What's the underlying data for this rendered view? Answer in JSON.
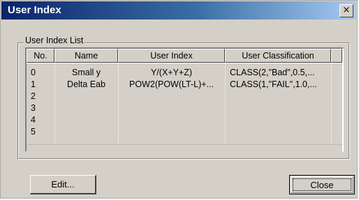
{
  "window": {
    "title": "User Index",
    "close_glyph": "×"
  },
  "group": {
    "label": "User Index List"
  },
  "table": {
    "columns": [
      "No.",
      "Name",
      "User Index",
      "User Classification"
    ],
    "rows": [
      {
        "no": "0",
        "name": "Small y",
        "index": "Y/(X+Y+Z)",
        "classification": "CLASS(2,\"Bad\",0.5,..."
      },
      {
        "no": "1",
        "name": "Delta Eab",
        "index": "POW2(POW(LT-L)+...",
        "classification": "CLASS(1,\"FAIL\",1.0,..."
      },
      {
        "no": "2",
        "name": "",
        "index": "",
        "classification": ""
      },
      {
        "no": "3",
        "name": "",
        "index": "",
        "classification": ""
      },
      {
        "no": "4",
        "name": "",
        "index": "",
        "classification": ""
      },
      {
        "no": "5",
        "name": "",
        "index": "",
        "classification": ""
      }
    ]
  },
  "buttons": {
    "edit": "Edit...",
    "close": "Close"
  }
}
